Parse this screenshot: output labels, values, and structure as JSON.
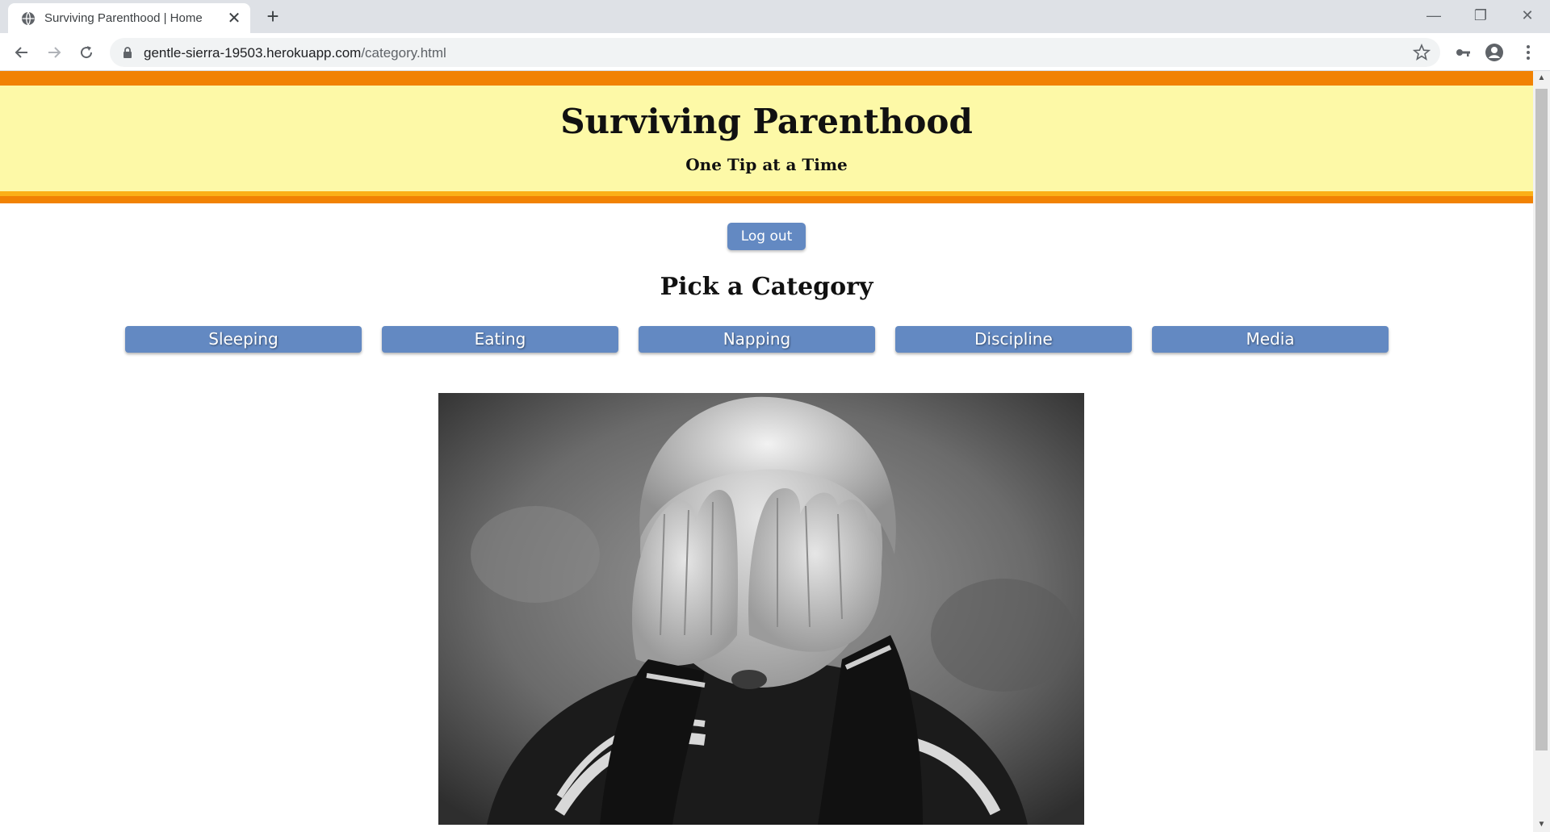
{
  "browser": {
    "tab_title": "Surviving Parenthood | Home",
    "url_host": "gentle-sierra-19503.herokuapp.com",
    "url_path": "/category.html"
  },
  "header": {
    "title": "Surviving Parenthood",
    "subtitle": "One Tip at a Time"
  },
  "logout_label": "Log out",
  "section_title": "Pick a Category",
  "categories": [
    "Sleeping",
    "Eating",
    "Napping",
    "Discipline",
    "Media"
  ],
  "colors": {
    "header_bg": "#fdf9a7",
    "header_border": "#f18203",
    "button_bg": "#6389c2"
  },
  "photo": {
    "description_icon": "child-covering-eyes-photo"
  }
}
